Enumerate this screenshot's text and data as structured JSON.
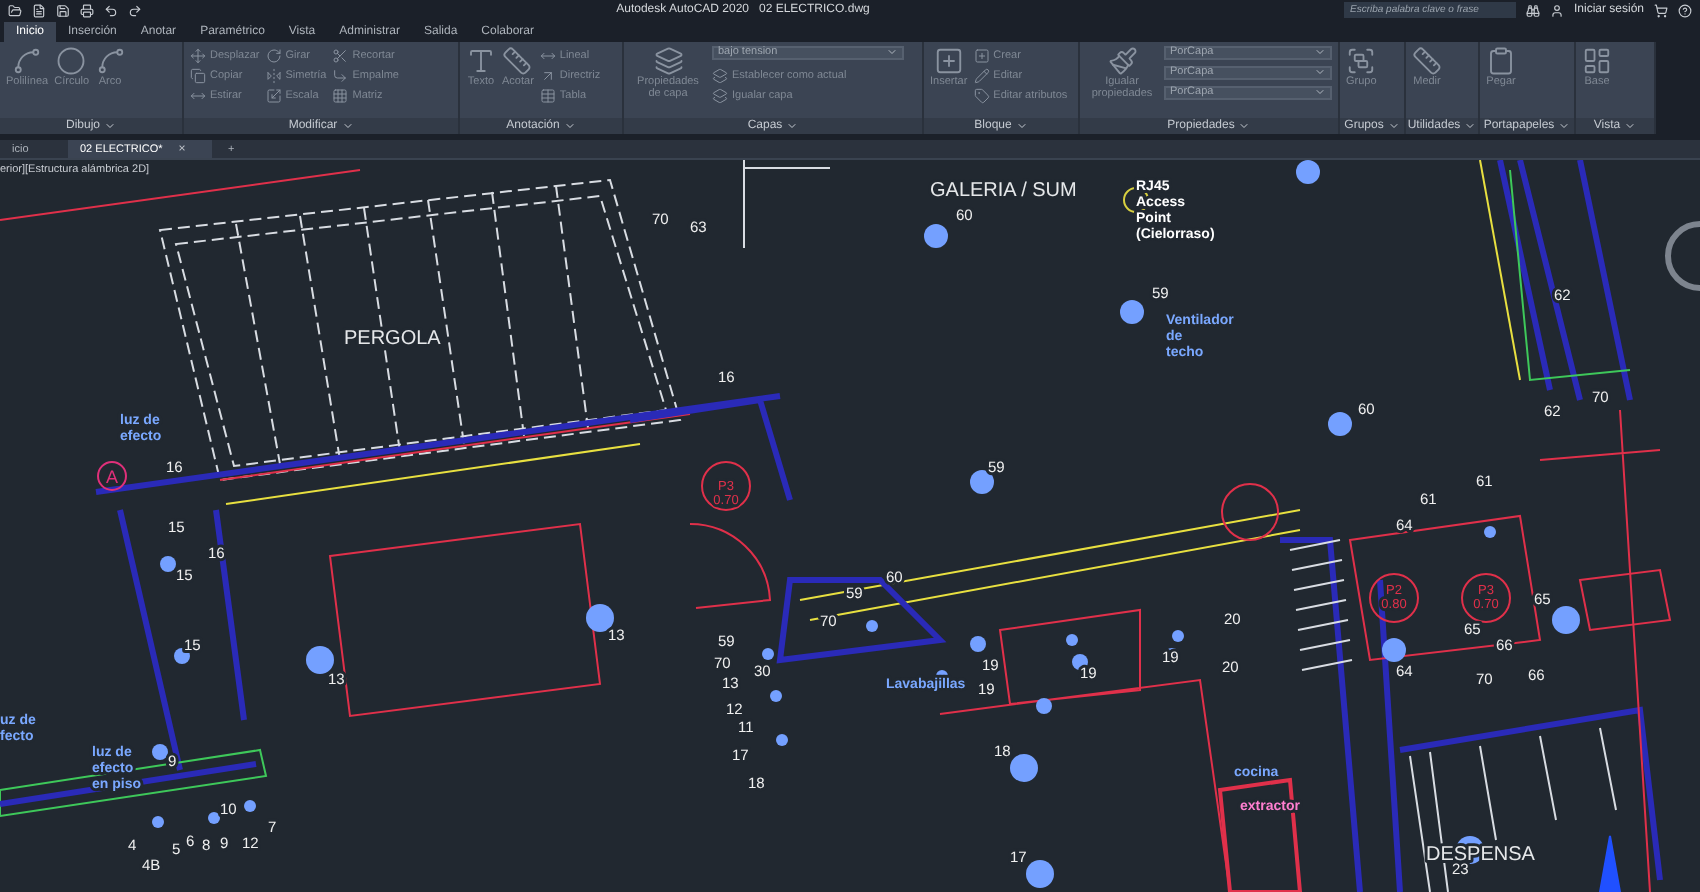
{
  "title_bar": {
    "title": "Autodesk AutoCAD 2020   02 ELECTRICO.dwg",
    "search": {
      "placeholder": "Escriba palabra clave o frase"
    },
    "sign_in": "Iniciar sesión"
  },
  "ribbon_tabs": [
    {
      "label": "Inicio",
      "selected": true
    },
    {
      "label": "Inserción",
      "selected": false
    },
    {
      "label": "Anotar",
      "selected": false
    },
    {
      "label": "Paramétrico",
      "selected": false
    },
    {
      "label": "Vista",
      "selected": false
    },
    {
      "label": "Administrar",
      "selected": false
    },
    {
      "label": "Salida",
      "selected": false
    },
    {
      "label": "Colaborar",
      "selected": false
    }
  ],
  "panels": [
    {
      "title": "Dibujo",
      "tools": [
        {
          "label": "Polilínea",
          "kind": "large"
        },
        {
          "label": "Círculo",
          "kind": "large"
        },
        {
          "label": "Arco",
          "kind": "large"
        }
      ]
    },
    {
      "title": "Modificar",
      "tools": [
        {
          "label": "Desplazar",
          "kind": "small"
        },
        {
          "label": "Girar",
          "kind": "small"
        },
        {
          "label": "Recortar",
          "kind": "small"
        },
        {
          "label": "Copiar",
          "kind": "small"
        },
        {
          "label": "Simetría",
          "kind": "small"
        },
        {
          "label": "Empalme",
          "kind": "small"
        },
        {
          "label": "Estirar",
          "kind": "small"
        },
        {
          "label": "Escala",
          "kind": "small"
        },
        {
          "label": "Matriz",
          "kind": "small"
        }
      ]
    },
    {
      "title": "Anotación",
      "tools": [
        {
          "label": "Texto",
          "kind": "large"
        },
        {
          "label": "Acotar",
          "kind": "large"
        },
        {
          "label": "Lineal",
          "kind": "small"
        },
        {
          "label": "Directriz",
          "kind": "small"
        },
        {
          "label": "Tabla",
          "kind": "small"
        }
      ]
    },
    {
      "title": "Capas",
      "tools": [
        {
          "label": "Propiedades de capa",
          "kind": "large"
        },
        {
          "label": "bajo tension",
          "kind": "dropdown"
        },
        {
          "label": "Establecer como actual",
          "kind": "small"
        },
        {
          "label": "Igualar capa",
          "kind": "small"
        }
      ]
    },
    {
      "title": "Bloque",
      "tools": [
        {
          "label": "Insertar",
          "kind": "large"
        },
        {
          "label": "Crear",
          "kind": "small"
        },
        {
          "label": "Editar",
          "kind": "small"
        },
        {
          "label": "Editar atributos",
          "kind": "small"
        }
      ]
    },
    {
      "title": "Propiedades",
      "tools": [
        {
          "label": "Igualar propiedades",
          "kind": "large"
        },
        {
          "label": "PorCapa",
          "kind": "dropdown"
        },
        {
          "label": "PorCapa",
          "kind": "dropdown"
        },
        {
          "label": "PorCapa",
          "kind": "dropdown"
        }
      ]
    },
    {
      "title": "Grupos",
      "tools": [
        {
          "label": "Grupo",
          "kind": "large"
        }
      ]
    },
    {
      "title": "Utilidades",
      "tools": [
        {
          "label": "Medir",
          "kind": "large"
        }
      ]
    },
    {
      "title": "Portapapeles",
      "tools": [
        {
          "label": "Pegar",
          "kind": "large"
        }
      ]
    },
    {
      "title": "Vista",
      "tools": [
        {
          "label": "Base",
          "kind": "large"
        }
      ]
    }
  ],
  "doc_tabs": [
    {
      "label": "icio",
      "selected": false,
      "closable": false
    },
    {
      "label": "02 ELECTRICO*",
      "selected": true,
      "closable": true
    }
  ],
  "close_glyph": "×",
  "new_tab": "+",
  "viewport_label": "erior][Estructura alámbrica 2D]",
  "drawing": {
    "rooms": [
      "GALERIA / SUM",
      "PERGOLA",
      "DESPENSA"
    ],
    "notes": [
      {
        "lines": [
          "RJ45",
          "Access",
          "Point",
          "(Cielorraso)"
        ],
        "kind": "white"
      },
      {
        "lines": [
          "Ventilador",
          "de",
          "techo"
        ],
        "kind": "blue"
      },
      {
        "lines": [
          "luz de",
          "efecto"
        ],
        "kind": "blue"
      },
      {
        "lines": [
          "uz de",
          "fecto"
        ],
        "kind": "blue"
      },
      {
        "lines": [
          "luz de",
          "efecto",
          "en piso"
        ],
        "kind": "blue"
      },
      {
        "lines": [
          "Lavabajillas"
        ],
        "kind": "blue"
      },
      {
        "lines": [
          "cocina"
        ],
        "kind": "blue"
      },
      {
        "lines": [
          "extractor"
        ],
        "kind": "pink"
      }
    ],
    "door_tags": [
      {
        "lines": [
          "P3",
          "0.70"
        ]
      },
      {
        "lines": [
          "P2",
          "0.80"
        ]
      },
      {
        "lines": [
          "P3",
          "0.70"
        ]
      }
    ],
    "markers": [
      "A"
    ],
    "numbers": [
      "70",
      "63",
      "60",
      "59",
      "60",
      "59",
      "62",
      "70",
      "62",
      "61",
      "61",
      "64",
      "16",
      "16",
      "15",
      "16",
      "15",
      "15",
      "13",
      "13",
      "60",
      "59",
      "70",
      "59",
      "70",
      "30",
      "13",
      "12",
      "11",
      "17",
      "18",
      "19",
      "19",
      "19",
      "19",
      "20",
      "20",
      "64",
      "65",
      "65",
      "66",
      "70",
      "66",
      "9",
      "10",
      "7",
      "4",
      "4B",
      "5",
      "6",
      "8",
      "9",
      "12",
      "18",
      "17",
      "23"
    ]
  }
}
